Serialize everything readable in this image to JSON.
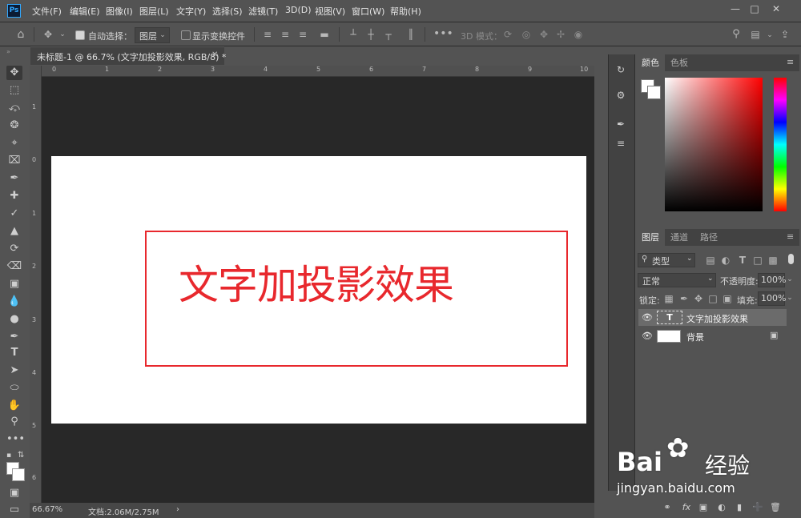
{
  "app": {
    "logo": "Ps"
  },
  "menu": [
    "文件(F)",
    "编辑(E)",
    "图像(I)",
    "图层(L)",
    "文字(Y)",
    "选择(S)",
    "滤镜(T)",
    "3D(D)",
    "视图(V)",
    "窗口(W)",
    "帮助(H)"
  ],
  "options": {
    "auto_select_label": "自动选择：",
    "auto_select_value": "图层",
    "show_transform_label": "显示变换控件",
    "three_d_mode_label": "3D 模式："
  },
  "document": {
    "tab_title": "未标题-1 @ 66.7% (文字加投影效果, RGB/8) *",
    "canvas_text": "文字加投影效果",
    "ruler_h_labels": [
      "0",
      "1",
      "2",
      "3",
      "4",
      "5",
      "6",
      "7",
      "8",
      "9",
      "10"
    ],
    "ruler_v_labels": [
      "1",
      "0",
      "1",
      "2",
      "3",
      "4",
      "5",
      "6"
    ]
  },
  "status": {
    "zoom": "66.67%",
    "doc_info": "文档:2.06M/2.75M"
  },
  "color_panel": {
    "tabs": [
      "颜色",
      "色板"
    ]
  },
  "layers_panel": {
    "tabs": [
      "图层",
      "通道",
      "路径"
    ],
    "filter_label": "类型",
    "blend_mode": "正常",
    "opacity_label": "不透明度:",
    "opacity_value": "100%",
    "lock_label": "锁定:",
    "fill_label": "填充:",
    "fill_value": "100%",
    "layers": [
      {
        "name": "文字加投影效果",
        "type": "text",
        "thumb_label": "T"
      },
      {
        "name": "背景",
        "type": "background"
      }
    ]
  },
  "colors": {
    "accent_red": "#e8282d",
    "canvas_white": "#ffffff",
    "workspace": "#282828"
  },
  "watermark": {
    "brand": "Bai",
    "brand2": "经验",
    "url": "jingyan.baidu.com"
  }
}
